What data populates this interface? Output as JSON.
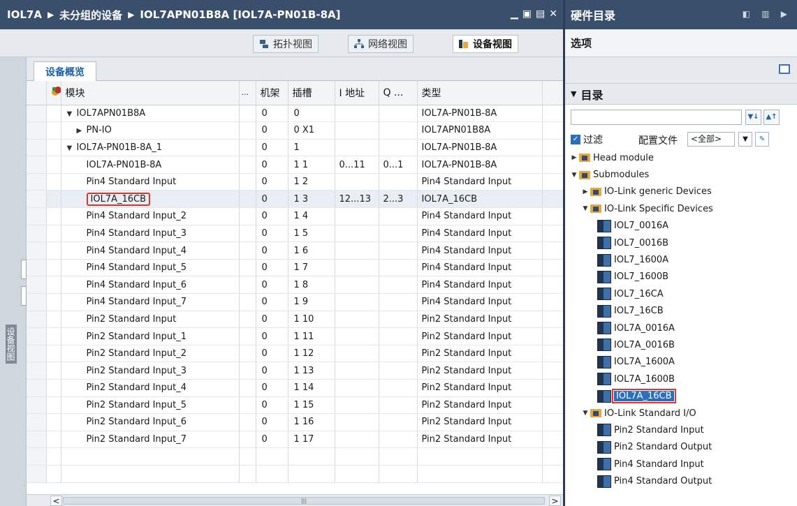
{
  "left": {
    "breadcrumb": [
      "IOL7A",
      "未分组的设备",
      "IOL7APN01B8A [IOL7A-PN01B-8A]"
    ],
    "views": {
      "topology": "拓扑视图",
      "network": "网络视图",
      "device": "设备视图"
    },
    "side_label": "设备视图",
    "tab": "设备概览",
    "columns": [
      "模块",
      "...",
      "机架",
      "插槽",
      "I 地址",
      "Q ...",
      "类型"
    ],
    "rows": [
      {
        "tree": "▼",
        "indent": 0,
        "module": "IOL7APN01B8A",
        "rack": "0",
        "slot": "0",
        "i": "",
        "q": "",
        "type": "IOL7A-PN01B-8A"
      },
      {
        "tree": "▶",
        "indent": 1,
        "module": "PN-IO",
        "rack": "0",
        "slot": "0 X1",
        "i": "",
        "q": "",
        "type": "IOL7APN01B8A"
      },
      {
        "tree": "▼",
        "indent": 0,
        "module": "IOL7A-PN01B-8A_1",
        "rack": "0",
        "slot": "1",
        "i": "",
        "q": "",
        "type": "IOL7A-PN01B-8A"
      },
      {
        "tree": "",
        "indent": 2,
        "module": "IOL7A-PN01B-8A",
        "rack": "0",
        "slot": "1 1",
        "i": "0...11",
        "q": "0...1",
        "type": "IOL7A-PN01B-8A"
      },
      {
        "tree": "",
        "indent": 2,
        "module": "Pin4 Standard Input",
        "rack": "0",
        "slot": "1 2",
        "i": "",
        "q": "",
        "type": "Pin4 Standard Input"
      },
      {
        "tree": "",
        "indent": 2,
        "module": "IOL7A_16CB",
        "rack": "0",
        "slot": "1 3",
        "i": "12...13",
        "q": "2...3",
        "type": "IOL7A_16CB",
        "selected": true
      },
      {
        "tree": "",
        "indent": 2,
        "module": "Pin4 Standard Input_2",
        "rack": "0",
        "slot": "1 4",
        "i": "",
        "q": "",
        "type": "Pin4 Standard Input"
      },
      {
        "tree": "",
        "indent": 2,
        "module": "Pin4 Standard Input_3",
        "rack": "0",
        "slot": "1 5",
        "i": "",
        "q": "",
        "type": "Pin4 Standard Input"
      },
      {
        "tree": "",
        "indent": 2,
        "module": "Pin4 Standard Input_4",
        "rack": "0",
        "slot": "1 6",
        "i": "",
        "q": "",
        "type": "Pin4 Standard Input"
      },
      {
        "tree": "",
        "indent": 2,
        "module": "Pin4 Standard Input_5",
        "rack": "0",
        "slot": "1 7",
        "i": "",
        "q": "",
        "type": "Pin4 Standard Input"
      },
      {
        "tree": "",
        "indent": 2,
        "module": "Pin4 Standard Input_6",
        "rack": "0",
        "slot": "1 8",
        "i": "",
        "q": "",
        "type": "Pin4 Standard Input"
      },
      {
        "tree": "",
        "indent": 2,
        "module": "Pin4 Standard Input_7",
        "rack": "0",
        "slot": "1 9",
        "i": "",
        "q": "",
        "type": "Pin4 Standard Input"
      },
      {
        "tree": "",
        "indent": 2,
        "module": "Pin2 Standard Input",
        "rack": "0",
        "slot": "1 10",
        "i": "",
        "q": "",
        "type": "Pin2 Standard Input"
      },
      {
        "tree": "",
        "indent": 2,
        "module": "Pin2 Standard Input_1",
        "rack": "0",
        "slot": "1 11",
        "i": "",
        "q": "",
        "type": "Pin2 Standard Input"
      },
      {
        "tree": "",
        "indent": 2,
        "module": "Pin2 Standard Input_2",
        "rack": "0",
        "slot": "1 12",
        "i": "",
        "q": "",
        "type": "Pin2 Standard Input"
      },
      {
        "tree": "",
        "indent": 2,
        "module": "Pin2 Standard Input_3",
        "rack": "0",
        "slot": "1 13",
        "i": "",
        "q": "",
        "type": "Pin2 Standard Input"
      },
      {
        "tree": "",
        "indent": 2,
        "module": "Pin2 Standard Input_4",
        "rack": "0",
        "slot": "1 14",
        "i": "",
        "q": "",
        "type": "Pin2 Standard Input"
      },
      {
        "tree": "",
        "indent": 2,
        "module": "Pin2 Standard Input_5",
        "rack": "0",
        "slot": "1 15",
        "i": "",
        "q": "",
        "type": "Pin2 Standard Input"
      },
      {
        "tree": "",
        "indent": 2,
        "module": "Pin2 Standard Input_6",
        "rack": "0",
        "slot": "1 16",
        "i": "",
        "q": "",
        "type": "Pin2 Standard Input"
      },
      {
        "tree": "",
        "indent": 2,
        "module": "Pin2 Standard Input_7",
        "rack": "0",
        "slot": "1 17",
        "i": "",
        "q": "",
        "type": "Pin2 Standard Input"
      },
      {
        "tree": "",
        "indent": 0,
        "module": "",
        "rack": "",
        "slot": "",
        "i": "",
        "q": "",
        "type": ""
      },
      {
        "tree": "",
        "indent": 0,
        "module": "",
        "rack": "",
        "slot": "",
        "i": "",
        "q": "",
        "type": ""
      }
    ],
    "scroll_thumb": "|||"
  },
  "right": {
    "title": "硬件目录",
    "options": "选项",
    "catalog": "目录",
    "search_value": "",
    "filter_label": "过滤",
    "profile_label": "配置文件",
    "profile_value": "<全部>",
    "tree": [
      {
        "level": 0,
        "tw": "▶",
        "icon": "folder",
        "label": "Head module"
      },
      {
        "level": 0,
        "tw": "▼",
        "icon": "folder",
        "label": "Submodules"
      },
      {
        "level": 1,
        "tw": "▶",
        "icon": "folder",
        "label": "IO-Link generic Devices"
      },
      {
        "level": 1,
        "tw": "▼",
        "icon": "folder",
        "label": "IO-Link Specific Devices"
      },
      {
        "level": 2,
        "tw": "",
        "icon": "device",
        "label": "IOL7_0016A"
      },
      {
        "level": 2,
        "tw": "",
        "icon": "device",
        "label": "IOL7_0016B"
      },
      {
        "level": 2,
        "tw": "",
        "icon": "device",
        "label": "IOL7_1600A"
      },
      {
        "level": 2,
        "tw": "",
        "icon": "device",
        "label": "IOL7_1600B"
      },
      {
        "level": 2,
        "tw": "",
        "icon": "device",
        "label": "IOL7_16CA"
      },
      {
        "level": 2,
        "tw": "",
        "icon": "device",
        "label": "IOL7_16CB"
      },
      {
        "level": 2,
        "tw": "",
        "icon": "device",
        "label": "IOL7A_0016A"
      },
      {
        "level": 2,
        "tw": "",
        "icon": "device",
        "label": "IOL7A_0016B"
      },
      {
        "level": 2,
        "tw": "",
        "icon": "device",
        "label": "IOL7A_1600A"
      },
      {
        "level": 2,
        "tw": "",
        "icon": "device",
        "label": "IOL7A_1600B"
      },
      {
        "level": 2,
        "tw": "",
        "icon": "device",
        "label": "IOL7A_16CB",
        "selected": true
      },
      {
        "level": 1,
        "tw": "▼",
        "icon": "folder",
        "label": "IO-Link Standard I/O"
      },
      {
        "level": 2,
        "tw": "",
        "icon": "device",
        "label": "Pin2 Standard Input"
      },
      {
        "level": 2,
        "tw": "",
        "icon": "device",
        "label": "Pin2 Standard Output"
      },
      {
        "level": 2,
        "tw": "",
        "icon": "device",
        "label": "Pin4 Standard Input"
      },
      {
        "level": 2,
        "tw": "",
        "icon": "device",
        "label": "Pin4 Standard Output"
      }
    ]
  },
  "colors": {
    "title_bar": "#3a4f6b",
    "selection": "#2a6fbd",
    "highlight": "#e0342b",
    "folder": "#e8a73a"
  }
}
